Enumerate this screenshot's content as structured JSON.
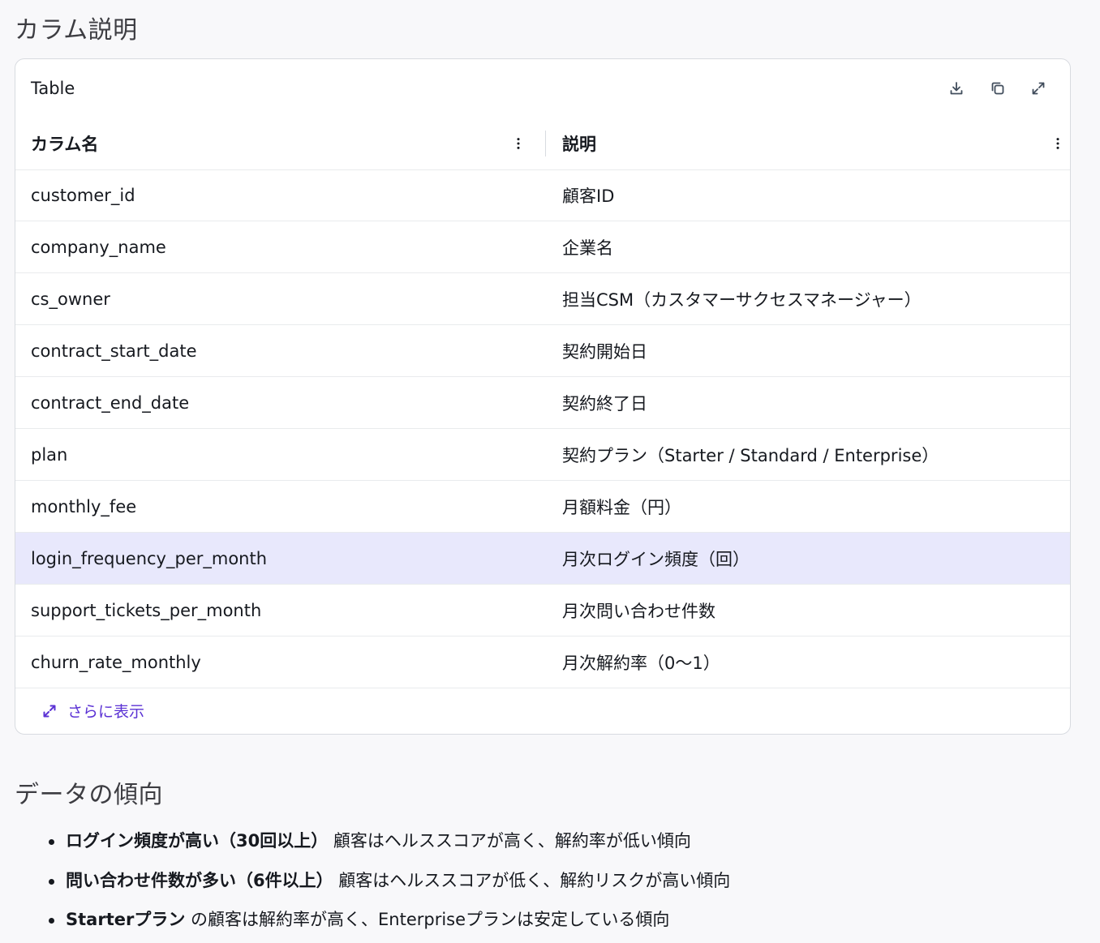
{
  "sections": {
    "columns_title": "カラム説明",
    "trends_title": "データの傾向"
  },
  "table": {
    "title": "Table",
    "toolbar": {
      "download_icon": "download-icon",
      "copy_icon": "copy-icon",
      "expand_icon": "expand-icon"
    },
    "headers": [
      "カラム名",
      "説明"
    ],
    "rows": [
      {
        "name": "customer_id",
        "desc": "顧客ID"
      },
      {
        "name": "company_name",
        "desc": "企業名"
      },
      {
        "name": "cs_owner",
        "desc": "担当CSM（カスタマーサクセスマネージャー）"
      },
      {
        "name": "contract_start_date",
        "desc": "契約開始日"
      },
      {
        "name": "contract_end_date",
        "desc": "契約終了日"
      },
      {
        "name": "plan",
        "desc": "契約プラン（Starter / Standard / Enterprise）"
      },
      {
        "name": "monthly_fee",
        "desc": "月額料金（円）"
      },
      {
        "name": "login_frequency_per_month",
        "desc": "月次ログイン頻度（回）"
      },
      {
        "name": "support_tickets_per_month",
        "desc": "月次問い合わせ件数"
      },
      {
        "name": "churn_rate_monthly",
        "desc": "月次解約率（0〜1）"
      }
    ],
    "highlighted_row_index": 7,
    "show_more_label": "さらに表示"
  },
  "trends": [
    {
      "bold": "ログイン頻度が高い（30回以上）",
      "text": " 顧客はヘルススコアが高く、解約率が低い傾向"
    },
    {
      "bold": "問い合わせ件数が多い（6件以上）",
      "text": " 顧客はヘルススコアが低く、解約リスクが高い傾向"
    },
    {
      "bold": "Starterプラン",
      "text": " の顧客は解約率が高く、Enterpriseプランは安定している傾向"
    }
  ],
  "colors": {
    "accent": "#5b32d4",
    "highlight_row": "#e8e8fc",
    "background": "#f8f8fa"
  }
}
